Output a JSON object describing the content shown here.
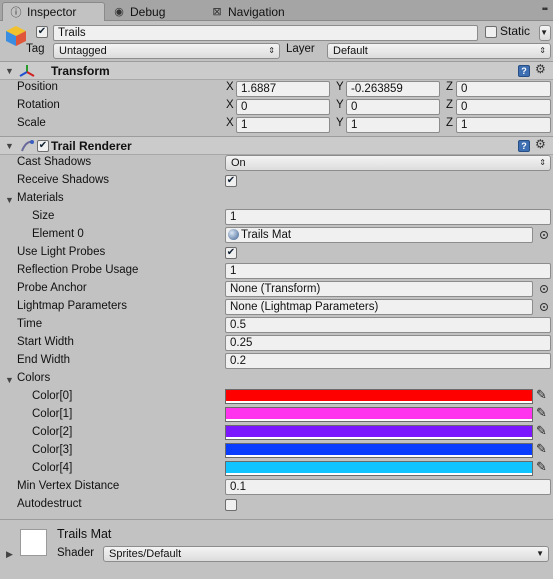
{
  "tabs": [
    {
      "label": "Inspector",
      "icon": "info-icon"
    },
    {
      "label": "Debug",
      "icon": "debug-icon"
    },
    {
      "label": "Navigation",
      "icon": "navigation-icon"
    }
  ],
  "header": {
    "name": "Trails",
    "active": true,
    "static_label": "Static",
    "static": false,
    "tag_label": "Tag",
    "tag_value": "Untagged",
    "layer_label": "Layer",
    "layer_value": "Default"
  },
  "transform": {
    "title": "Transform",
    "rows": [
      {
        "label": "Position",
        "x": "1.6887",
        "y": "-0.263859",
        "z": "0"
      },
      {
        "label": "Rotation",
        "x": "0",
        "y": "0",
        "z": "0"
      },
      {
        "label": "Scale",
        "x": "1",
        "y": "1",
        "z": "1"
      }
    ],
    "axes": {
      "x": "X",
      "y": "Y",
      "z": "Z"
    }
  },
  "trail_renderer": {
    "title": "Trail Renderer",
    "enabled": true,
    "cast_shadows_label": "Cast Shadows",
    "cast_shadows_value": "On",
    "receive_shadows_label": "Receive Shadows",
    "receive_shadows": true,
    "materials_label": "Materials",
    "size_label": "Size",
    "size_value": "1",
    "element0_label": "Element 0",
    "element0_value": "Trails Mat",
    "use_light_probes_label": "Use Light Probes",
    "use_light_probes": true,
    "reflection_label": "Reflection Probe Usage",
    "reflection_value": "1",
    "probe_anchor_label": "Probe Anchor",
    "probe_anchor_value": "None (Transform)",
    "lightmap_label": "Lightmap Parameters",
    "lightmap_value": "None (Lightmap Parameters)",
    "time_label": "Time",
    "time_value": "0.5",
    "start_width_label": "Start Width",
    "start_width_value": "0.25",
    "end_width_label": "End Width",
    "end_width_value": "0.2",
    "colors_label": "Colors",
    "colors": [
      {
        "label": "Color[0]",
        "hex": "#ff0000"
      },
      {
        "label": "Color[1]",
        "hex": "#ff33ee"
      },
      {
        "label": "Color[2]",
        "hex": "#7a17ff"
      },
      {
        "label": "Color[3]",
        "hex": "#0a3cff"
      },
      {
        "label": "Color[4]",
        "hex": "#0fc4ff"
      }
    ],
    "min_vertex_label": "Min Vertex Distance",
    "min_vertex_value": "0.1",
    "autodestruct_label": "Autodestruct",
    "autodestruct": false
  },
  "material": {
    "name": "Trails Mat",
    "shader_label": "Shader",
    "shader_value": "Sprites/Default"
  }
}
